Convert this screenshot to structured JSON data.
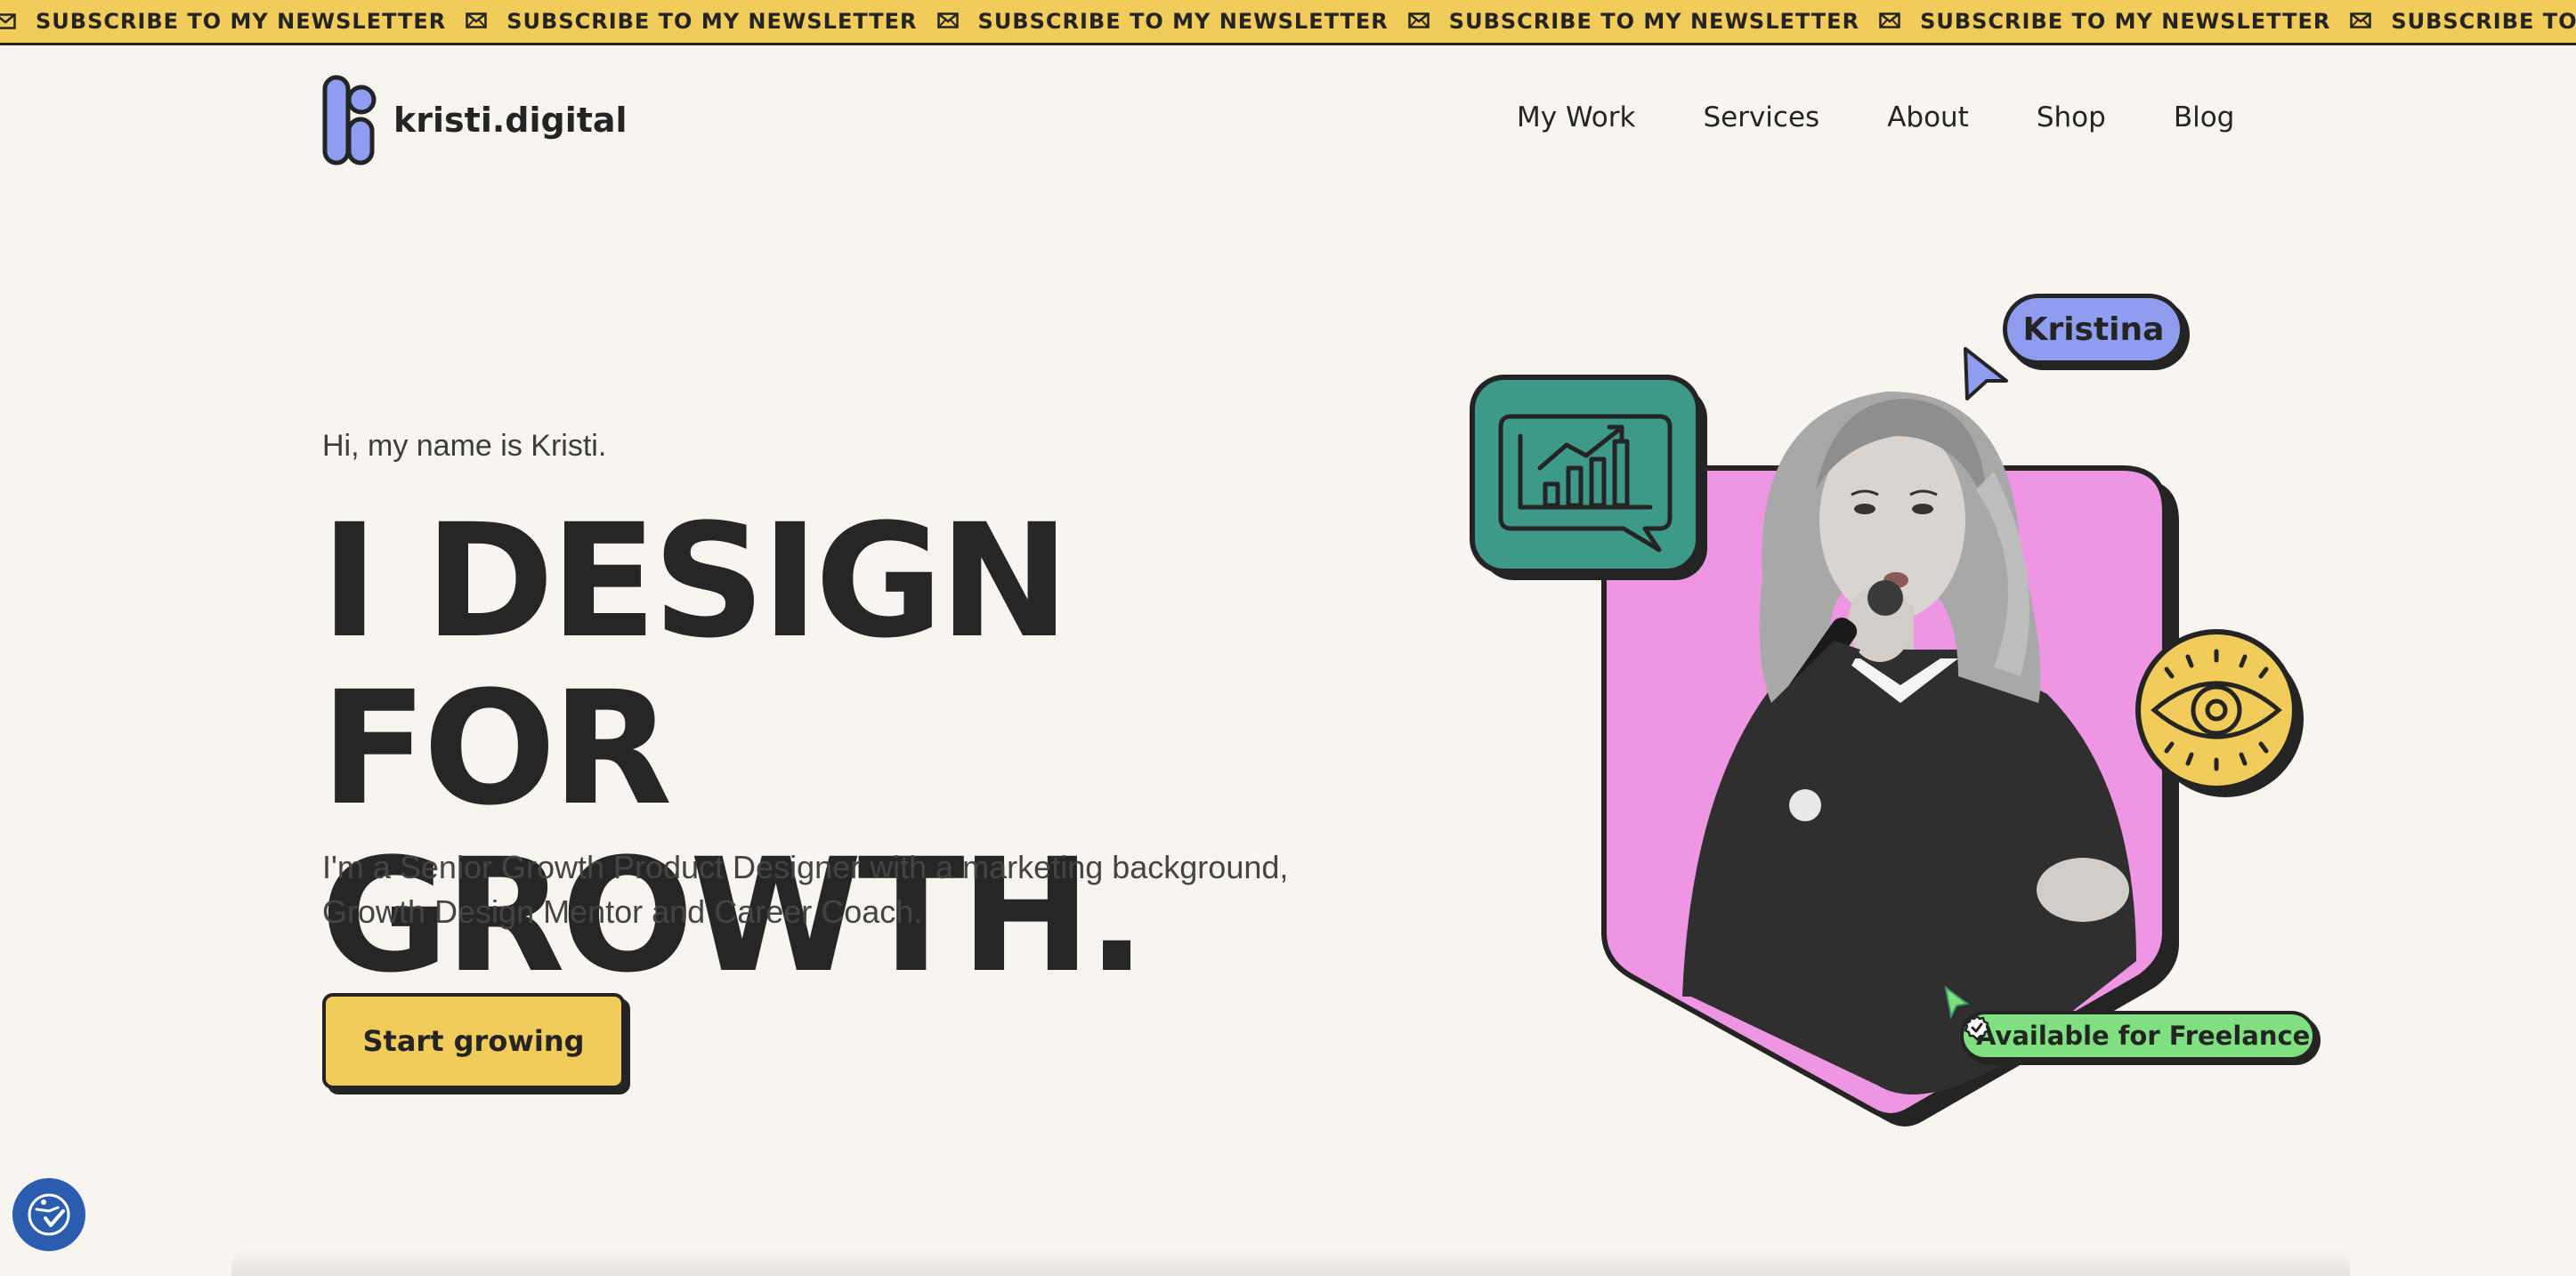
{
  "ticker": {
    "text": "SUBSCRIBE TO MY NEWSLETTER",
    "items": [
      "SUBSCRIBE TO MY NEWSLETTER",
      "SUBSCRIBE TO MY NEWSLETTER",
      "SUBSCRIBE TO MY NEWSLETTER",
      "SUBSCRIBE TO MY NEWSLETTER",
      "SUBSCRIBE TO MY NEWSLETTER",
      "SUBSCRIBE TO MY NEWSLETTER",
      "SUBSCRIBE TO MY NEWSLETTER",
      "SUBSCRIBE TO MY NEWSLETTER"
    ],
    "icon": "envelope-icon",
    "color": "#f2cc5a"
  },
  "header": {
    "logo_text": "kristi.digital",
    "nav": [
      {
        "label": "My Work"
      },
      {
        "label": "Services"
      },
      {
        "label": "About"
      },
      {
        "label": "Shop"
      },
      {
        "label": "Blog"
      }
    ]
  },
  "hero": {
    "greeting": "Hi, my name is Kristi.",
    "headline_line1": "I DESIGN FOR",
    "headline_line2": "GROWTH.",
    "bio_line1": "I'm a Senior Growth Product Designer with a marketing background,",
    "bio_line2": "Growth Design Mentor and Career Coach.",
    "cta_label": "Start growing",
    "name_tag": "Kristina",
    "status_badge": "Available for Freelance"
  },
  "colors": {
    "background": "#f8f5f1",
    "yellow": "#f2cc5a",
    "pink": "#ee95e3",
    "teal": "#3e9a88",
    "periwinkle": "#8e9df0",
    "green": "#7ee07e",
    "dark": "#242424",
    "accessibility_blue": "#2a5db0"
  },
  "icons": [
    "envelope-icon",
    "growth-chart-icon",
    "eye-icon",
    "cursor-arrow-icon",
    "verified-check-icon",
    "accessibility-icon"
  ]
}
